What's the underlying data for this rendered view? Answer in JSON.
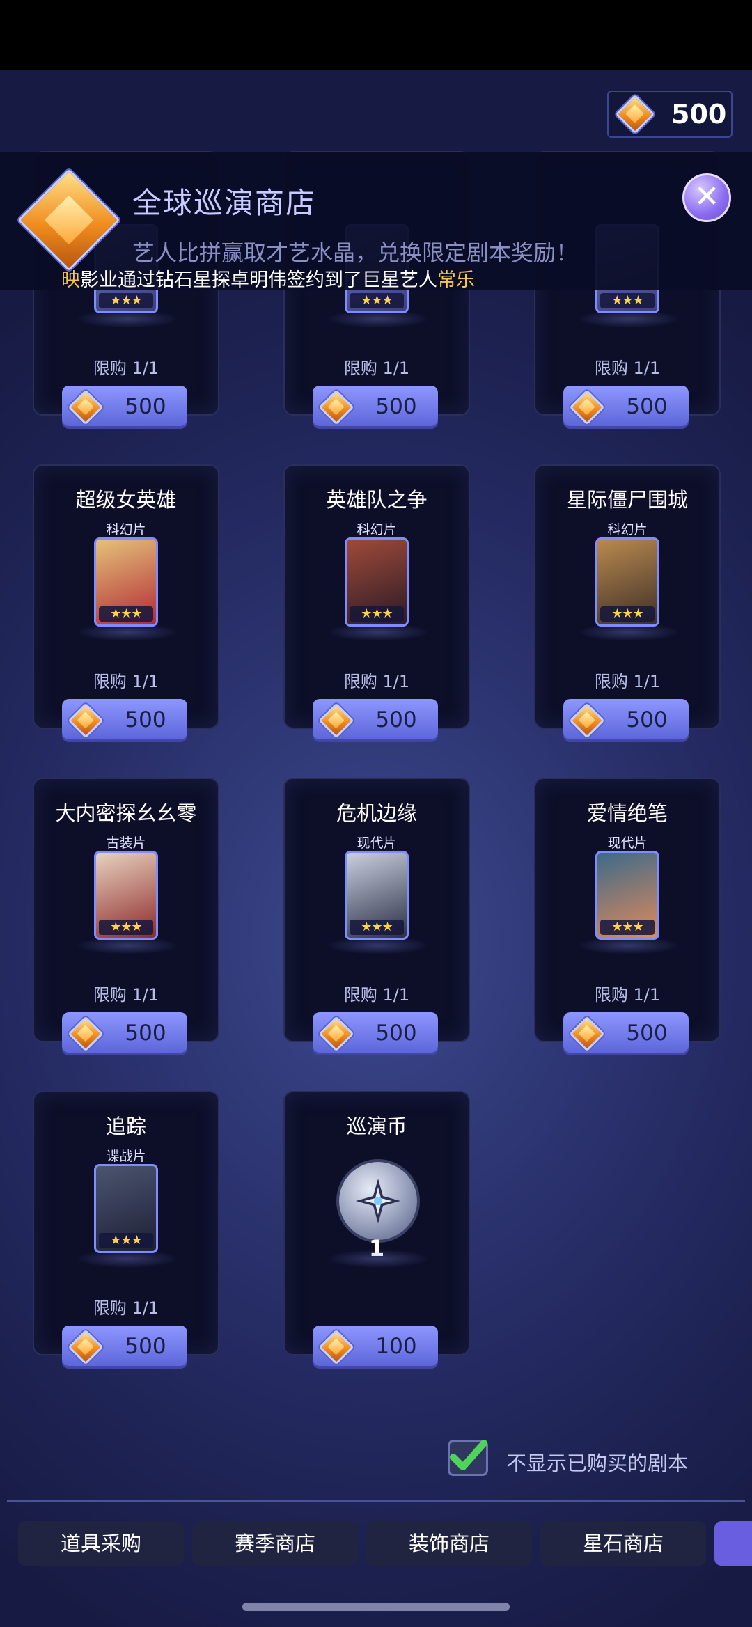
{
  "currency": {
    "icon": "crystal-gem-icon",
    "amount": "500"
  },
  "shop": {
    "title": "全球巡演商店",
    "subtitle": "艺人比拼赢取才艺水晶，兑换限定剧本奖励！",
    "close_icon": "close-icon",
    "ticker_prefix": "映",
    "ticker_text": "影业通过钻石星探卓明伟签约到了巨星艺人",
    "ticker_artist": "常乐"
  },
  "items": [
    {
      "title": "",
      "genre": "",
      "limit": "限购 1/1",
      "price": "500",
      "stars": "★★★"
    },
    {
      "title": "",
      "genre": "",
      "limit": "限购 1/1",
      "price": "500",
      "stars": "★★★"
    },
    {
      "title": "",
      "genre": "",
      "limit": "限购 1/1",
      "price": "500",
      "stars": "★★★"
    },
    {
      "title": "超级女英雄",
      "genre": "科幻片",
      "limit": "限购 1/1",
      "price": "500",
      "stars": "★★★"
    },
    {
      "title": "英雄队之争",
      "genre": "科幻片",
      "limit": "限购 1/1",
      "price": "500",
      "stars": "★★★"
    },
    {
      "title": "星际僵尸围城",
      "genre": "科幻片",
      "limit": "限购 1/1",
      "price": "500",
      "stars": "★★★"
    },
    {
      "title": "大内密探幺幺零",
      "genre": "古装片",
      "limit": "限购 1/1",
      "price": "500",
      "stars": "★★★"
    },
    {
      "title": "危机边缘",
      "genre": "现代片",
      "limit": "限购 1/1",
      "price": "500",
      "stars": "★★★"
    },
    {
      "title": "爱情绝笔",
      "genre": "现代片",
      "limit": "限购 1/1",
      "price": "500",
      "stars": "★★★"
    },
    {
      "title": "追踪",
      "genre": "谍战片",
      "limit": "限购 1/1",
      "price": "500",
      "stars": "★★★"
    },
    {
      "title": "巡演币",
      "quantity": "1",
      "price": "100",
      "icon": "tour-coin-icon"
    }
  ],
  "filter": {
    "label": "不显示已购买的剧本",
    "checked": true
  },
  "tabs": [
    "道具采购",
    "赛季商店",
    "装饰商店",
    "星石商店"
  ],
  "colors": {
    "accent": "#6a5ee0",
    "price_button": "#7a84f0",
    "highlight": "#f5c64a"
  }
}
